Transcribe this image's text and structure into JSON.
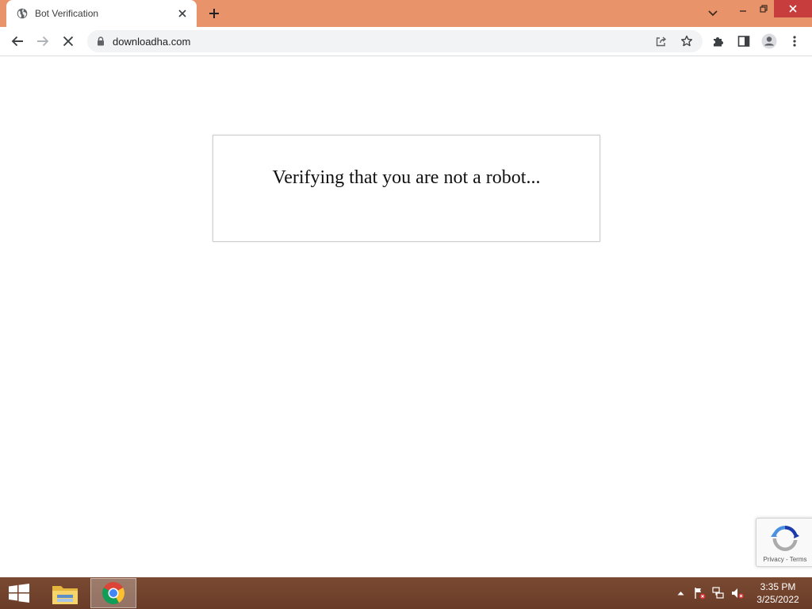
{
  "browser": {
    "tab": {
      "title": "Bot Verification",
      "favicon": "globe-icon"
    },
    "address": {
      "url": "downloadha.com"
    },
    "accent_color": "#e9936b"
  },
  "page": {
    "verify_message": "Verifying that you are not a robot..."
  },
  "recaptcha": {
    "privacy_label": "Privacy",
    "separator": "-",
    "terms_label": "Terms"
  },
  "taskbar": {
    "time": "3:35 PM",
    "date": "3/25/2022"
  }
}
